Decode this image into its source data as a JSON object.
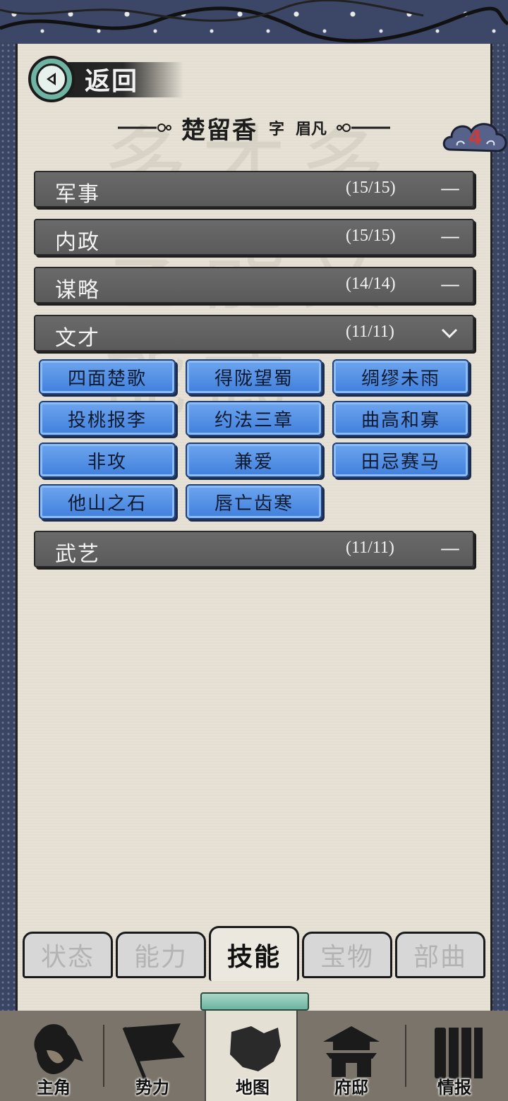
{
  "header": {
    "back_label": "返回",
    "name": "楚留香",
    "zi_label": "字",
    "courtesy_name": "眉凡",
    "badge_count": "4"
  },
  "categories": [
    {
      "name": "军事",
      "count": "(15/15)",
      "toggle": "—"
    },
    {
      "name": "内政",
      "count": "(15/15)",
      "toggle": "—"
    },
    {
      "name": "谋略",
      "count": "(14/14)",
      "toggle": "—"
    },
    {
      "name": "文才",
      "count": "(11/11)",
      "toggle": "chevron-down"
    },
    {
      "name": "武艺",
      "count": "(11/11)",
      "toggle": "—"
    }
  ],
  "skills": [
    "四面楚歌",
    "得陇望蜀",
    "绸缪未雨",
    "投桃报李",
    "约法三章",
    "曲高和寡",
    "非攻",
    "兼爱",
    "田忌赛马",
    "他山之石",
    "唇亡齿寒"
  ],
  "inner_tabs": [
    "状态",
    "能力",
    "技能",
    "宝物",
    "部曲"
  ],
  "active_inner_tab": "技能",
  "bottom_nav": [
    "主角",
    "势力",
    "地图",
    "府邸",
    "情报"
  ],
  "active_bottom_nav": "地图",
  "colors": {
    "skill_blue": "#4f8de3",
    "category_gray": "#616161",
    "badge_red": "#c43e3e",
    "parchment": "#e7e2d5"
  },
  "watermark": "多才多艺能文能武"
}
